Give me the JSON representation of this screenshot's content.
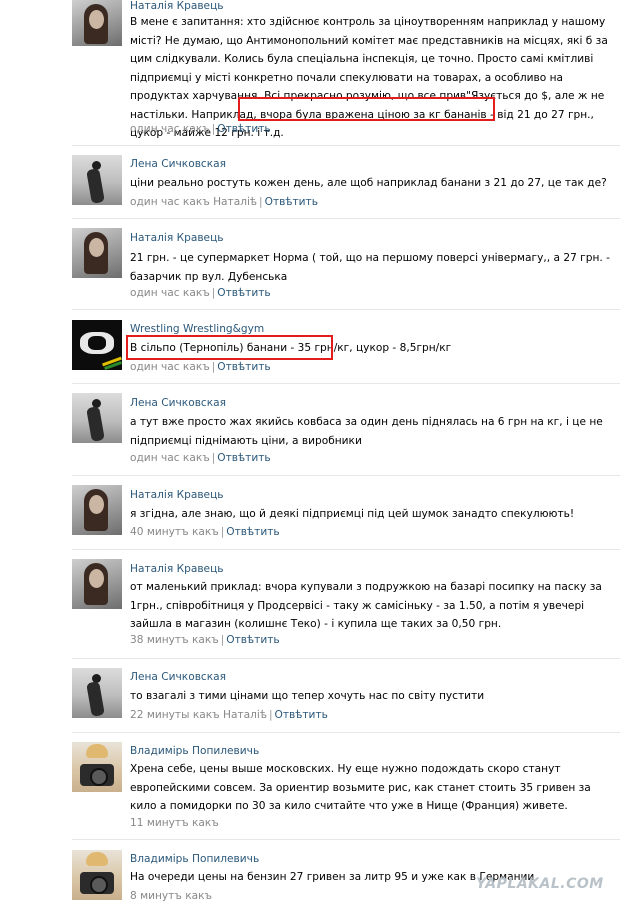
{
  "comments": [
    {
      "name": "Наталія Кравець",
      "text": "В мене є запитання: хто здійснює контроль за ціноутворенням наприклад у нашому місті? Не думаю, що Антимонопольний комітет має представників на місцях, які б за цим слідкували. Колись була спеціальна інспекція, це точно. Просто самі кмітливі підприємці у місті конкретно почали спекулювати на товарах, а особливо на продуктах харчування. Всі прекрасно розумію, що все прив\"Язується до $, але ж не настільки. Наприклад, вчора була вражена ціною за кг бананів - від 21 до 27 грн., цукор - майже 12 грн. і т.д.",
      "time": "один час какъ",
      "reply_to": "",
      "reply": "Отвѣтить"
    },
    {
      "name": "Лена Сичковская",
      "text": "ціни реально ростуть кожен день, але щоб наприклад банани з 21 до 27, це так де?",
      "time": "один час какъ",
      "reply_to": "Наталіѣ",
      "reply": "Отвѣтить"
    },
    {
      "name": "Наталія Кравець",
      "text": "21 грн. - це супермаркет Норма ( той, що на першому поверсі універмагу,, а 27 грн. - базарчик пр вул. Дубенська",
      "time": "один час какъ",
      "reply_to": "",
      "reply": "Отвѣтить"
    },
    {
      "name": "Wrestling Wrestling&gym",
      "text": "В сільпо (Тернопіль) банани - 35 грн/кг, цукор - 8,5грн/кг",
      "time": "один час какъ",
      "reply_to": "",
      "reply": "Отвѣтить"
    },
    {
      "name": "Лена Сичковская",
      "text": "а тут вже просто жах якийсь ковбаса за один день піднялась на 6 грн на кг, і це не підприємці піднімають ціни, а виробники",
      "time": "один час какъ",
      "reply_to": "",
      "reply": "Отвѣтить"
    },
    {
      "name": "Наталія Кравець",
      "text": "я згідна, але знаю, що й деякі підприємці під цей шумок занадто спекулюють!",
      "time": "40 минутъ какъ",
      "reply_to": "",
      "reply": "Отвѣтить"
    },
    {
      "name": "Наталія Кравець",
      "text": "от маленький приклад: вчора купували з подружкою на базарі посипку на паску за 1грн., співробітниця у Продсервісі - таку ж самісіньку - за 1.50, а потім я увечері зайшла в магазин (колишнє Теко) - і купила ще таких за 0,50 грн.",
      "time": "38 минутъ какъ",
      "reply_to": "",
      "reply": "Отвѣтить"
    },
    {
      "name": "Лена Сичковская",
      "text": "то взагалі з тими цінами що тепер хочуть нас по світу пустити",
      "time": "22 минуты какъ",
      "reply_to": "Наталіѣ",
      "reply": "Отвѣтить"
    },
    {
      "name": "Владимірь Попилевичь",
      "text": "Хрена себе, цены выше московских. Ну еще нужно подождать скоро станут европейскими совсем. За ориентир возьмите рис, как станет стоить 35 гривен за кило а помидорки по 30 за кило считайте что уже в Нище (Франция) живете.",
      "time": "11 минутъ какъ",
      "reply_to": "",
      "reply": ""
    },
    {
      "name": "Владимірь Попилевичь",
      "text": "На очереди цены на бензин 27 гривен за литр 95 и уже как в Германии.",
      "time": "8 минутъ какъ",
      "reply_to": "",
      "reply": ""
    }
  ],
  "watermark": "YAPLAKAL.COM",
  "colors": {
    "link": "#2b587a",
    "meta": "#888888",
    "highlight": "#e31c1c"
  }
}
